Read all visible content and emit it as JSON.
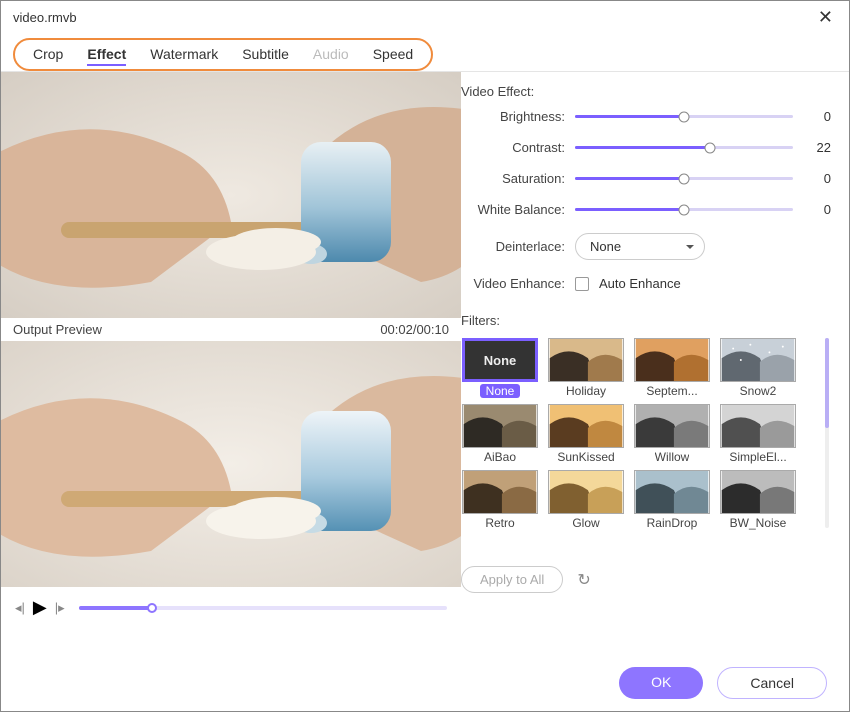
{
  "title": "video.rmvb",
  "tabs": [
    {
      "label": "Crop",
      "state": "normal"
    },
    {
      "label": "Effect",
      "state": "active"
    },
    {
      "label": "Watermark",
      "state": "normal"
    },
    {
      "label": "Subtitle",
      "state": "normal"
    },
    {
      "label": "Audio",
      "state": "disabled"
    },
    {
      "label": "Speed",
      "state": "normal"
    }
  ],
  "preview": {
    "output_label": "Output Preview",
    "timecode": "00:02/00:10"
  },
  "effects": {
    "section_label": "Video Effect:",
    "sliders": {
      "brightness": {
        "label": "Brightness:",
        "value": 0,
        "pos_pct": 50
      },
      "contrast": {
        "label": "Contrast:",
        "value": 22,
        "pos_pct": 62
      },
      "saturation": {
        "label": "Saturation:",
        "value": 0,
        "pos_pct": 50
      },
      "white_balance": {
        "label": "White Balance:",
        "value": 0,
        "pos_pct": 50
      }
    },
    "deinterlace": {
      "label": "Deinterlace:",
      "value": "None"
    },
    "enhance": {
      "label": "Video Enhance:",
      "checkbox_label": "Auto Enhance",
      "checked": false
    }
  },
  "filters": {
    "label": "Filters:",
    "items": [
      {
        "name": "None",
        "selected": true
      },
      {
        "name": "Holiday"
      },
      {
        "name": "Septem..."
      },
      {
        "name": "Snow2"
      },
      {
        "name": "AiBao"
      },
      {
        "name": "SunKissed"
      },
      {
        "name": "Willow"
      },
      {
        "name": "SimpleEl..."
      },
      {
        "name": "Retro"
      },
      {
        "name": "Glow"
      },
      {
        "name": "RainDrop"
      },
      {
        "name": "BW_Noise"
      }
    ],
    "apply_all": "Apply to All"
  },
  "footer": {
    "ok": "OK",
    "cancel": "Cancel"
  }
}
